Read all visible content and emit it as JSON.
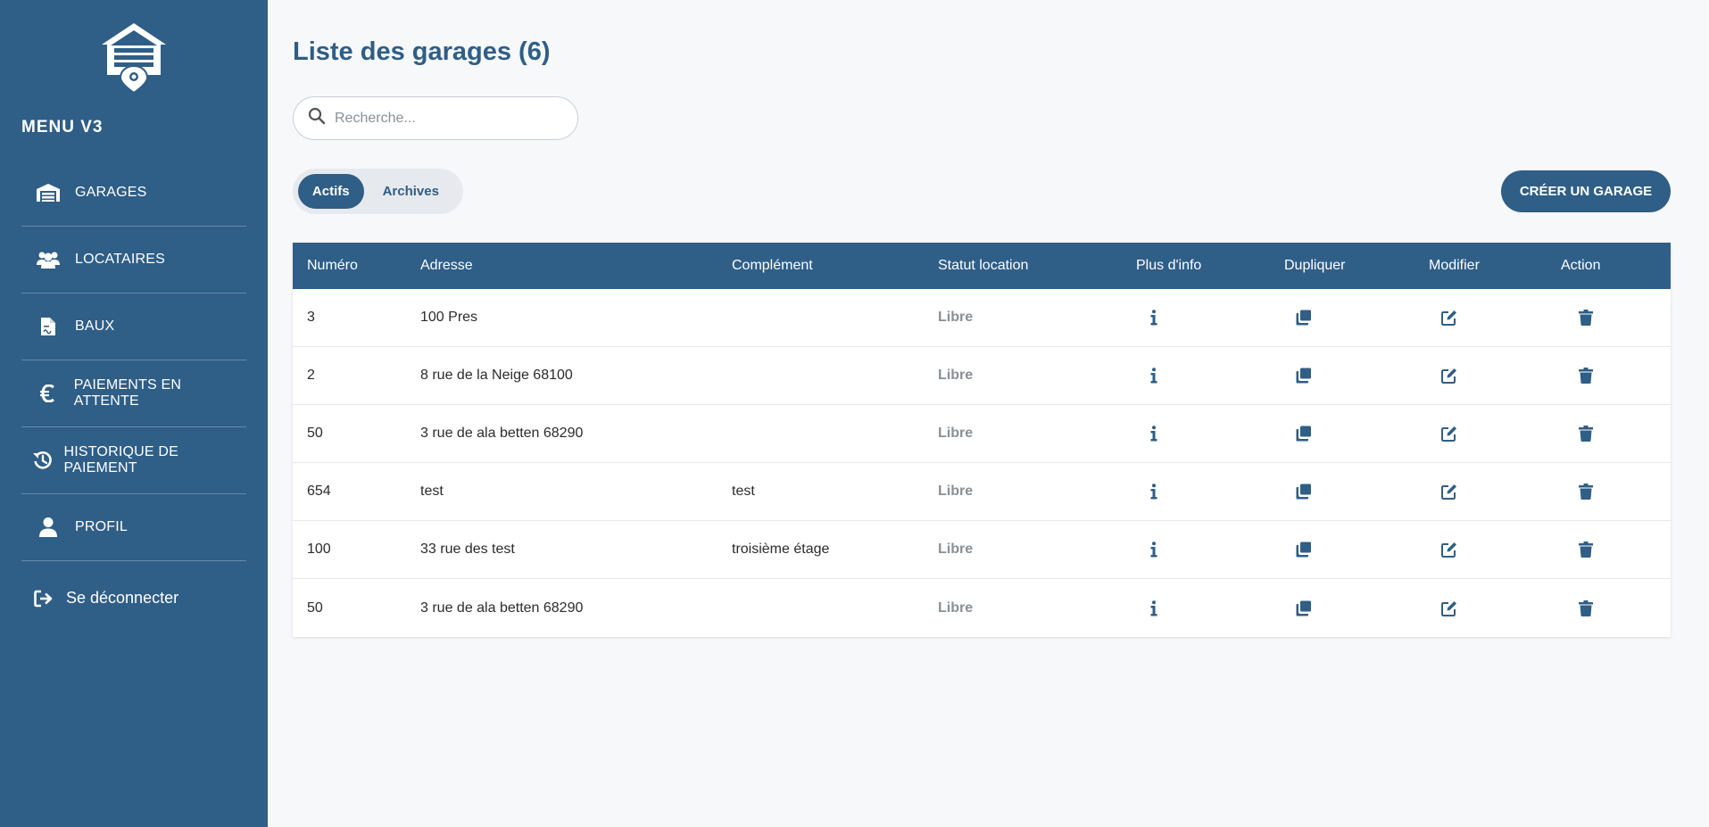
{
  "sidebar": {
    "menu_title": "MENU V3",
    "items": [
      {
        "label": "GARAGES",
        "icon": "warehouse-icon"
      },
      {
        "label": "LOCATAIRES",
        "icon": "users-icon"
      },
      {
        "label": "BAUX",
        "icon": "file-contract-icon"
      },
      {
        "label": "PAIEMENTS EN ATTENTE",
        "icon": "euro-icon"
      },
      {
        "label": "HISTORIQUE DE PAIEMENT",
        "icon": "history-icon"
      },
      {
        "label": "PROFIL",
        "icon": "user-icon"
      }
    ],
    "logout_label": "Se déconnecter"
  },
  "main": {
    "title": "Liste des garages (6)",
    "search_placeholder": "Recherche...",
    "tabs": [
      {
        "label": "Actifs",
        "active": true
      },
      {
        "label": "Archives",
        "active": false
      }
    ],
    "create_button": "CRÉER UN GARAGE"
  },
  "table": {
    "headers": [
      "Numéro",
      "Adresse",
      "Complément",
      "Statut location",
      "Plus d'info",
      "Dupliquer",
      "Modifier",
      "Action"
    ],
    "rows": [
      {
        "numero": "3",
        "adresse": "100 Pres",
        "complement": "",
        "statut": "Libre"
      },
      {
        "numero": "2",
        "adresse": "8 rue de la Neige 68100",
        "complement": "",
        "statut": "Libre"
      },
      {
        "numero": "50",
        "adresse": "3 rue de ala betten 68290",
        "complement": "",
        "statut": "Libre"
      },
      {
        "numero": "654",
        "adresse": "test",
        "complement": "test",
        "statut": "Libre"
      },
      {
        "numero": "100",
        "adresse": "33 rue des test",
        "complement": "troisième étage",
        "statut": "Libre"
      },
      {
        "numero": "50",
        "adresse": "3 rue de ala betten 68290",
        "complement": "",
        "statut": "Libre"
      }
    ]
  },
  "colors": {
    "primary": "#2f5e87",
    "background": "#f7f8fa",
    "muted_text": "#8a8f96"
  }
}
